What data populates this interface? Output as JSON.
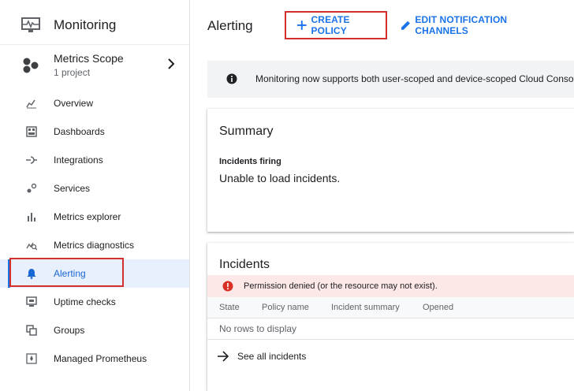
{
  "sidebar": {
    "app_title": "Monitoring",
    "scope": {
      "title": "Metrics Scope",
      "subtitle": "1 project"
    },
    "items": [
      {
        "label": "Overview",
        "icon": "overview-icon"
      },
      {
        "label": "Dashboards",
        "icon": "dashboards-icon"
      },
      {
        "label": "Integrations",
        "icon": "integrations-icon"
      },
      {
        "label": "Services",
        "icon": "services-icon"
      },
      {
        "label": "Metrics explorer",
        "icon": "bar-chart-icon"
      },
      {
        "label": "Metrics diagnostics",
        "icon": "diagnostics-icon"
      },
      {
        "label": "Alerting",
        "icon": "bell-icon",
        "active": true
      },
      {
        "label": "Uptime checks",
        "icon": "monitor-icon"
      },
      {
        "label": "Groups",
        "icon": "groups-icon"
      },
      {
        "label": "Managed Prometheus",
        "icon": "prometheus-icon"
      }
    ]
  },
  "header": {
    "title": "Alerting",
    "create_policy": "CREATE POLICY",
    "edit_channels": "EDIT NOTIFICATION CHANNELS"
  },
  "banner": {
    "text": "Monitoring now supports both user-scoped and device-scoped Cloud Console"
  },
  "summary": {
    "title": "Summary",
    "incidents_label": "Incidents firing",
    "incidents_value": "Unable to load incidents."
  },
  "incidents": {
    "title": "Incidents",
    "error": "Permission denied (or the resource may not exist).",
    "columns": [
      "State",
      "Policy name",
      "Incident summary",
      "Opened"
    ],
    "empty": "No rows to display",
    "see_all": "See all incidents"
  },
  "colors": {
    "accent": "#1a73e8",
    "highlight": "#d32f2f",
    "error_bg": "#fce8e6",
    "error_icon": "#d93025"
  }
}
